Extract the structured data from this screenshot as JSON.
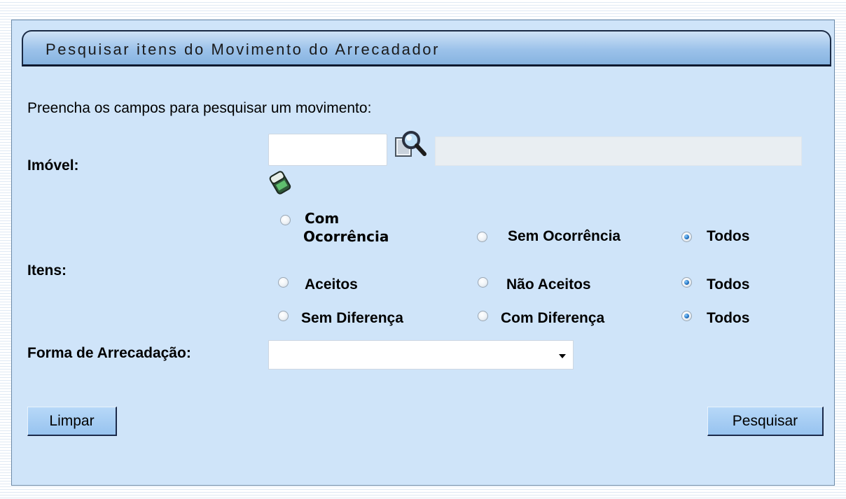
{
  "form": {
    "title": "Pesquisar itens do Movimento do Arrecadador",
    "intro": "Preencha os campos para pesquisar um movimento:",
    "imovel": {
      "label": "Imóvel:",
      "code_value": "",
      "description_value": "",
      "search_icon": "magnifier-icon",
      "clear_icon": "eraser-icon"
    },
    "itens": {
      "label": "Itens:",
      "rows": [
        {
          "options": [
            {
              "label": "Com Ocorrência",
              "checked": false
            },
            {
              "label": "Sem Ocorrência",
              "checked": false
            },
            {
              "label": "Todos",
              "checked": true
            }
          ]
        },
        {
          "options": [
            {
              "label": "Aceitos",
              "checked": false
            },
            {
              "label": "Não Aceitos",
              "checked": false
            },
            {
              "label": "Todos",
              "checked": true
            }
          ]
        },
        {
          "options": [
            {
              "label": "Sem Diferença",
              "checked": false
            },
            {
              "label": "Com Diferença",
              "checked": false
            },
            {
              "label": "Todos",
              "checked": true
            }
          ]
        }
      ]
    },
    "forma_arrecadacao": {
      "label": "Forma de Arrecadação:",
      "selected": ""
    },
    "buttons": {
      "clear": "Limpar",
      "search": "Pesquisar"
    }
  },
  "colors": {
    "panel_bg": "#cfe4f9",
    "title_bar": "#9cc2ea",
    "button_bg": "#a8cdf4",
    "radio_selected": "#1f6fc0"
  }
}
